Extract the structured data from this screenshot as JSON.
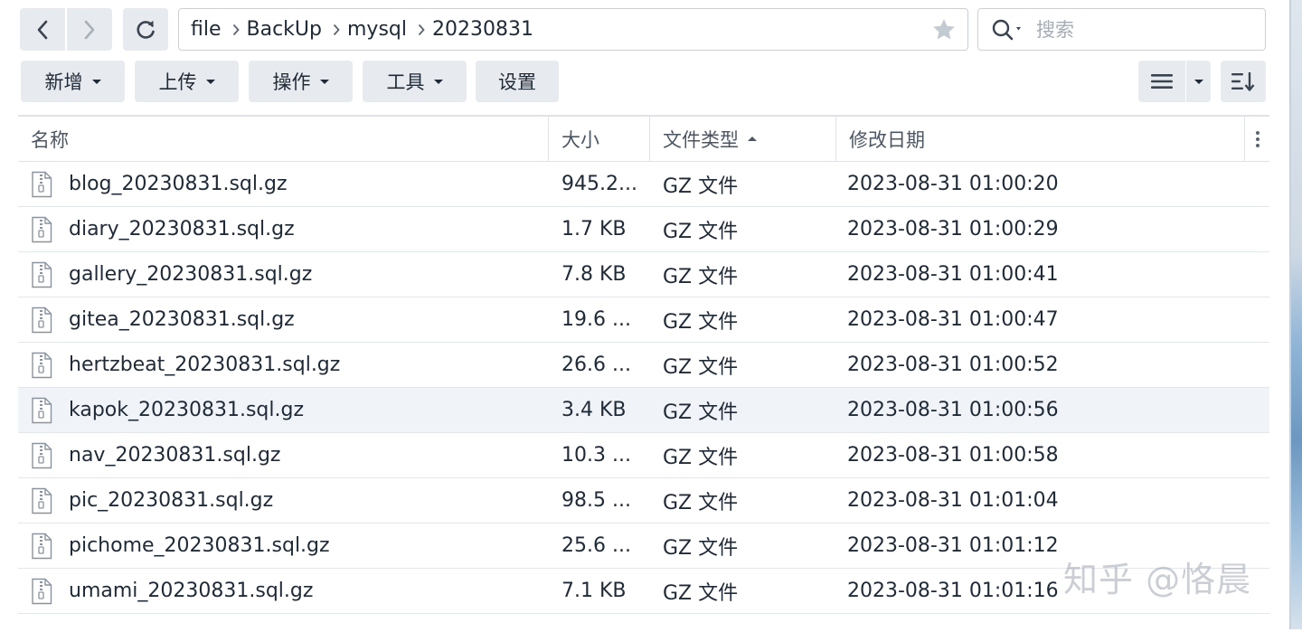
{
  "nav": {
    "breadcrumb": [
      "file",
      "BackUp",
      "mysql",
      "20230831"
    ]
  },
  "search": {
    "placeholder": "搜索"
  },
  "toolbar": {
    "new_label": "新增",
    "upload_label": "上传",
    "action_label": "操作",
    "tools_label": "工具",
    "settings_label": "设置"
  },
  "table": {
    "headers": {
      "name": "名称",
      "size": "大小",
      "type": "文件类型",
      "date": "修改日期"
    },
    "rows": [
      {
        "name": "blog_20230831.sql.gz",
        "size": "945.2...",
        "type": "GZ 文件",
        "date": "2023-08-31 01:00:20"
      },
      {
        "name": "diary_20230831.sql.gz",
        "size": "1.7 KB",
        "type": "GZ 文件",
        "date": "2023-08-31 01:00:29"
      },
      {
        "name": "gallery_20230831.sql.gz",
        "size": "7.8 KB",
        "type": "GZ 文件",
        "date": "2023-08-31 01:00:41"
      },
      {
        "name": "gitea_20230831.sql.gz",
        "size": "19.6 ...",
        "type": "GZ 文件",
        "date": "2023-08-31 01:00:47"
      },
      {
        "name": "hertzbeat_20230831.sql.gz",
        "size": "26.6 ...",
        "type": "GZ 文件",
        "date": "2023-08-31 01:00:52"
      },
      {
        "name": "kapok_20230831.sql.gz",
        "size": "3.4 KB",
        "type": "GZ 文件",
        "date": "2023-08-31 01:00:56"
      },
      {
        "name": "nav_20230831.sql.gz",
        "size": "10.3 ...",
        "type": "GZ 文件",
        "date": "2023-08-31 01:00:58"
      },
      {
        "name": "pic_20230831.sql.gz",
        "size": "98.5 ...",
        "type": "GZ 文件",
        "date": "2023-08-31 01:01:04"
      },
      {
        "name": "pichome_20230831.sql.gz",
        "size": "25.6 ...",
        "type": "GZ 文件",
        "date": "2023-08-31 01:01:12"
      },
      {
        "name": "umami_20230831.sql.gz",
        "size": "7.1 KB",
        "type": "GZ 文件",
        "date": "2023-08-31 01:01:16"
      }
    ]
  },
  "watermark": "知乎 @恪晨",
  "icons": {
    "back": "chevron-left-icon",
    "forward": "chevron-right-icon",
    "refresh": "refresh-icon",
    "favorite": "star-icon",
    "search": "search-icon",
    "view": "list-view-icon",
    "sort": "sort-icon",
    "more": "more-vertical-icon",
    "file": "zip-file-icon"
  },
  "colors": {
    "button_bg": "#e7ebef",
    "border": "#c8d0d8",
    "row_highlight": "#f0f4f9",
    "text": "#1f2a36"
  }
}
